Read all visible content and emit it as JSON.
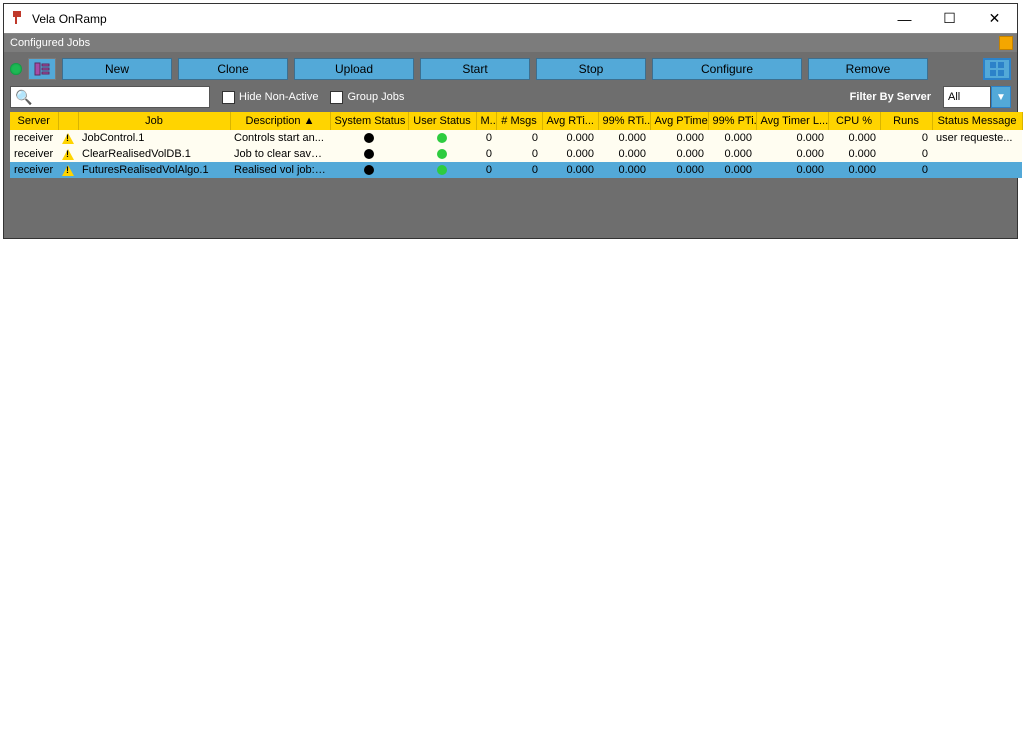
{
  "window": {
    "title": "Vela OnRamp",
    "panel_title": "Configured Jobs"
  },
  "toolbar": {
    "new": "New",
    "clone": "Clone",
    "upload": "Upload",
    "start": "Start",
    "stop": "Stop",
    "configure": "Configure",
    "remove": "Remove"
  },
  "row2": {
    "hide_non_active": "Hide Non-Active",
    "group_jobs": "Group Jobs",
    "filter_by_server": "Filter By Server",
    "filter_value": "All"
  },
  "columns": {
    "server": "Server",
    "job": "Job",
    "description": "Description ▲",
    "system_status": "System Status",
    "user_status": "User Status",
    "m": "M...",
    "msgs": "# Msgs",
    "avg_rti": "Avg RTi...",
    "p99_rti": "99% RTi...",
    "avg_ptime": "Avg PTime",
    "p99_pti": "99% PTi...",
    "avg_timer": "Avg Timer L...",
    "cpu": "CPU %",
    "runs": "Runs",
    "status_msg": "Status Message"
  },
  "rows": [
    {
      "server": "receiver",
      "job": "JobControl.1",
      "desc": "Controls start an...",
      "m": "0",
      "msgs": "0",
      "art": "0.000",
      "p99rt": "0.000",
      "apt": "0.000",
      "p99pt": "0.000",
      "atl": "0.000",
      "cpu": "0.000",
      "runs": "0",
      "sm": "user requeste..."
    },
    {
      "server": "receiver",
      "job": "ClearRealisedVolDB.1",
      "desc": "Job to clear save...",
      "m": "0",
      "msgs": "0",
      "art": "0.000",
      "p99rt": "0.000",
      "apt": "0.000",
      "p99pt": "0.000",
      "atl": "0.000",
      "cpu": "0.000",
      "runs": "0",
      "sm": ""
    },
    {
      "server": "receiver",
      "job": "FuturesRealisedVolAlgo.1",
      "desc": "Realised vol job: ...",
      "m": "0",
      "msgs": "0",
      "art": "0.000",
      "p99rt": "0.000",
      "apt": "0.000",
      "p99pt": "0.000",
      "atl": "0.000",
      "cpu": "0.000",
      "runs": "0",
      "sm": ""
    }
  ]
}
